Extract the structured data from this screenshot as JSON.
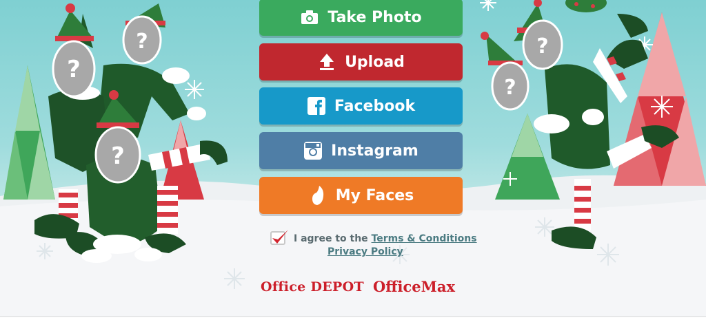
{
  "buttons": {
    "take_photo": "Take Photo",
    "upload": "Upload",
    "facebook": "Facebook",
    "instagram": "Instagram",
    "my_faces": "My Faces"
  },
  "agreement": {
    "checked": true,
    "prefix": "I agree to the",
    "terms_link": "Terms & Conditions",
    "privacy_link": "Privacy Policy"
  },
  "logos": {
    "office_depot": "Office DEPOT",
    "officemax": "OfficeMax"
  },
  "colors": {
    "take_photo": "#3aaa5e",
    "upload": "#c0282f",
    "facebook": "#1799c9",
    "instagram": "#4f7ea6",
    "my_faces": "#ef7a26",
    "brand_red": "#cc1f2a",
    "sky": "#8fd6d7"
  },
  "icons": {
    "take_photo": "camera-icon",
    "upload": "upload-arrow-icon",
    "facebook": "facebook-icon",
    "instagram": "instagram-icon",
    "my_faces": "face-silhouette-icon"
  }
}
